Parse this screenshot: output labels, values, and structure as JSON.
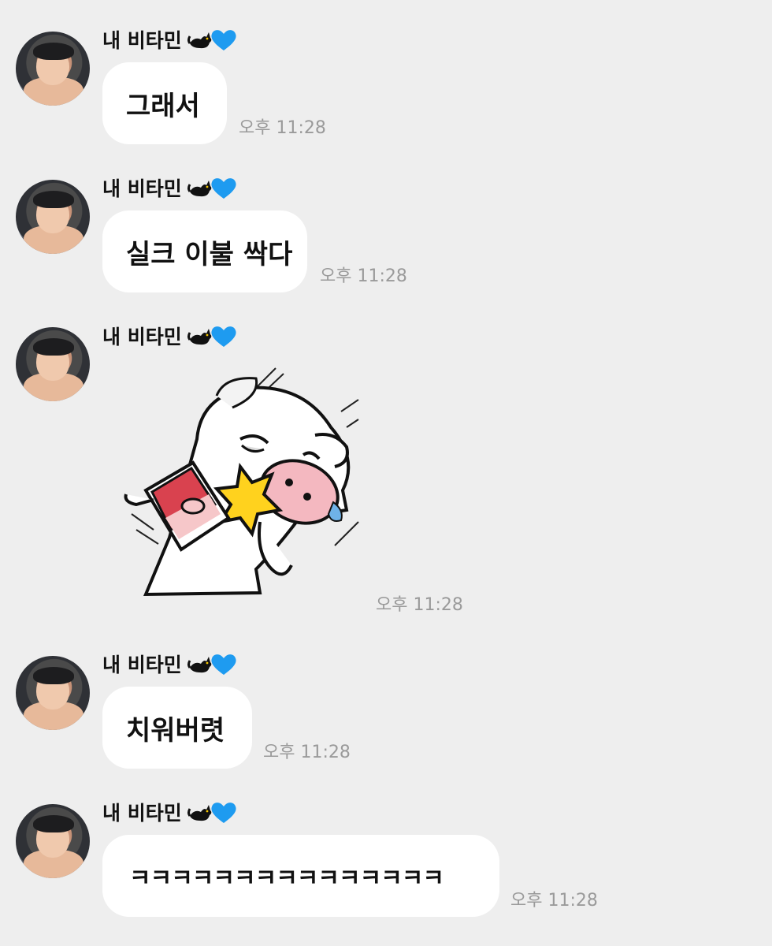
{
  "messages": [
    {
      "sender": "내 비타민",
      "text": "그래서",
      "time": "오후 11:28"
    },
    {
      "sender": "내 비타민",
      "text": "실크 이불 싹다",
      "time": "오후 11:28"
    },
    {
      "sender": "내 비타민",
      "sticker": "pig-dog-slap-sticker",
      "time": "오후 11:28"
    },
    {
      "sender": "내 비타민",
      "text": "치워버렷",
      "time": "오후 11:28"
    },
    {
      "sender": "내 비타민",
      "text": "ㅋㅋㅋㅋㅋㅋㅋㅋㅋㅋㅋㅋㅋㅋㅋ",
      "time": "오후 11:28"
    }
  ],
  "colors": {
    "background": "#eeeeee",
    "bubble": "#ffffff",
    "time": "#9a9a9a",
    "heart": "#1e9bf0"
  },
  "icons": [
    "black-cat-emoji",
    "blue-heart-emoji",
    "profile-avatar"
  ]
}
